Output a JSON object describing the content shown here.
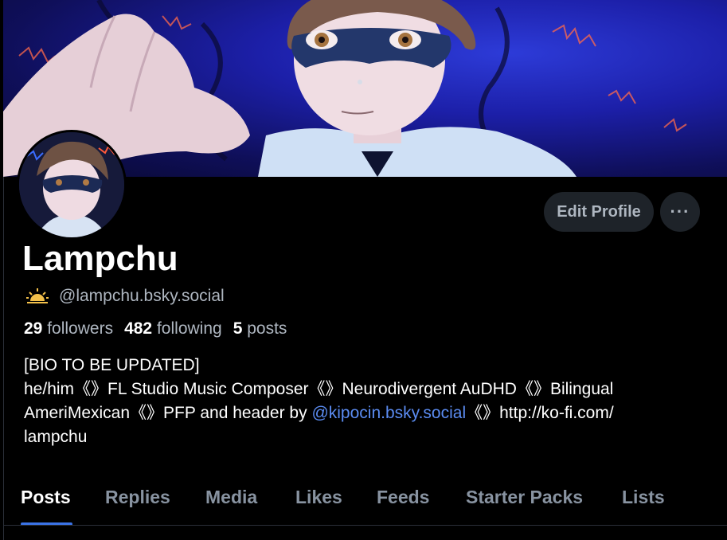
{
  "profile": {
    "display_name": "Lampchu",
    "handle": "@lampchu.bsky.social",
    "handle_icon": "sunrise-icon"
  },
  "actions": {
    "edit_profile": "Edit Profile",
    "more": "···"
  },
  "stats": {
    "followers_count": "29",
    "followers_label": "followers",
    "following_count": "482",
    "following_label": "following",
    "posts_count": "5",
    "posts_label": "posts"
  },
  "bio": {
    "line1": "[BIO TO BE UPDATED]",
    "line2": "he/him《》FL Studio Music Composer《》Neurodivergent AuDHD《》Bilingual",
    "line3_before": "AmeriMexican《》PFP and header by ",
    "line3_mention": "@kipocin.bsky.social",
    "line3_after": "《》http://ko-fi.com/",
    "line4": "lampchu"
  },
  "tabs": [
    "Posts",
    "Replies",
    "Media",
    "Likes",
    "Feeds",
    "Starter Packs",
    "Lists"
  ],
  "active_tab": "Posts",
  "colors": {
    "accent": "#3b73e6",
    "mention": "#5b8cf2",
    "background": "#000000",
    "button_bg": "#1e2329"
  }
}
